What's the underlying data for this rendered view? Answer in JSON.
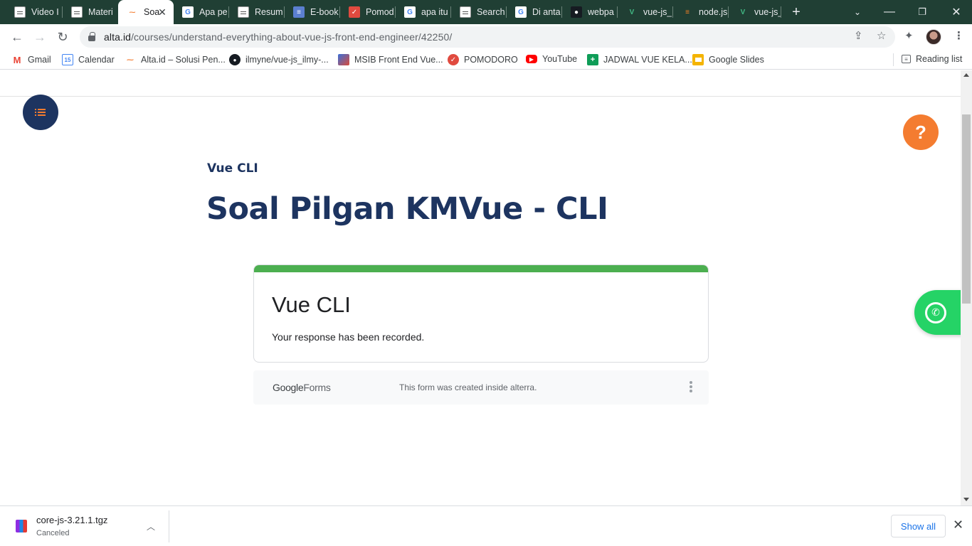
{
  "tabs": [
    {
      "title": "Video I",
      "favicon": "document-icon"
    },
    {
      "title": "Materi",
      "favicon": "document-icon"
    },
    {
      "title": "Soa",
      "favicon": "alta-icon",
      "active": true
    },
    {
      "title": "Apa pe",
      "favicon": "google-icon"
    },
    {
      "title": "Resum",
      "favicon": "document-icon"
    },
    {
      "title": "E-book",
      "favicon": "book-icon"
    },
    {
      "title": "Pomod",
      "favicon": "pomodoro-icon"
    },
    {
      "title": "apa itu",
      "favicon": "google-icon"
    },
    {
      "title": "Search",
      "favicon": "search-page-icon"
    },
    {
      "title": "Di anta",
      "favicon": "google-icon"
    },
    {
      "title": "webpa",
      "favicon": "github-icon"
    },
    {
      "title": "vue-js_",
      "favicon": "vue-icon"
    },
    {
      "title": "node.js",
      "favicon": "stackoverflow-icon"
    },
    {
      "title": "vue-js_",
      "favicon": "vue-icon"
    }
  ],
  "toolbar": {
    "url_host": "alta.id",
    "url_path": "/courses/understand-everything-about-vue-js-front-end-engineer/42250/"
  },
  "bookmarks": [
    {
      "label": "Gmail",
      "icon": "gmail-icon"
    },
    {
      "label": "Calendar",
      "icon": "calendar-icon",
      "badge": "15"
    },
    {
      "label": "Alta.id – Solusi Pen...",
      "icon": "alta-icon"
    },
    {
      "label": "ilmyne/vue-js_ilmy-...",
      "icon": "github-icon"
    },
    {
      "label": "MSIB Front End Vue...",
      "icon": "image-icon"
    },
    {
      "label": "POMODORO",
      "icon": "pomodoro-icon"
    },
    {
      "label": "YouTube",
      "icon": "youtube-icon"
    },
    {
      "label": "JADWAL VUE KELA...",
      "icon": "sheets-icon"
    },
    {
      "label": "Google Slides",
      "icon": "slides-icon"
    }
  ],
  "reading_list": "Reading list",
  "page": {
    "category": "Vue CLI",
    "title": "Soal Pilgan KMVue - CLI",
    "help_symbol": "?",
    "form": {
      "title": "Vue CLI",
      "message": "Your response has been recorded.",
      "brand_google": "Google",
      "brand_forms": "Forms",
      "footer_note": "This form was created inside alterra.",
      "accent_color": "#4caf50"
    }
  },
  "downloads": {
    "file_name": "core-js-3.21.1.tgz",
    "status": "Canceled",
    "show_all": "Show all"
  },
  "colors": {
    "navy": "#1d3460",
    "orange": "#f47c30",
    "whatsapp": "#25d366"
  }
}
